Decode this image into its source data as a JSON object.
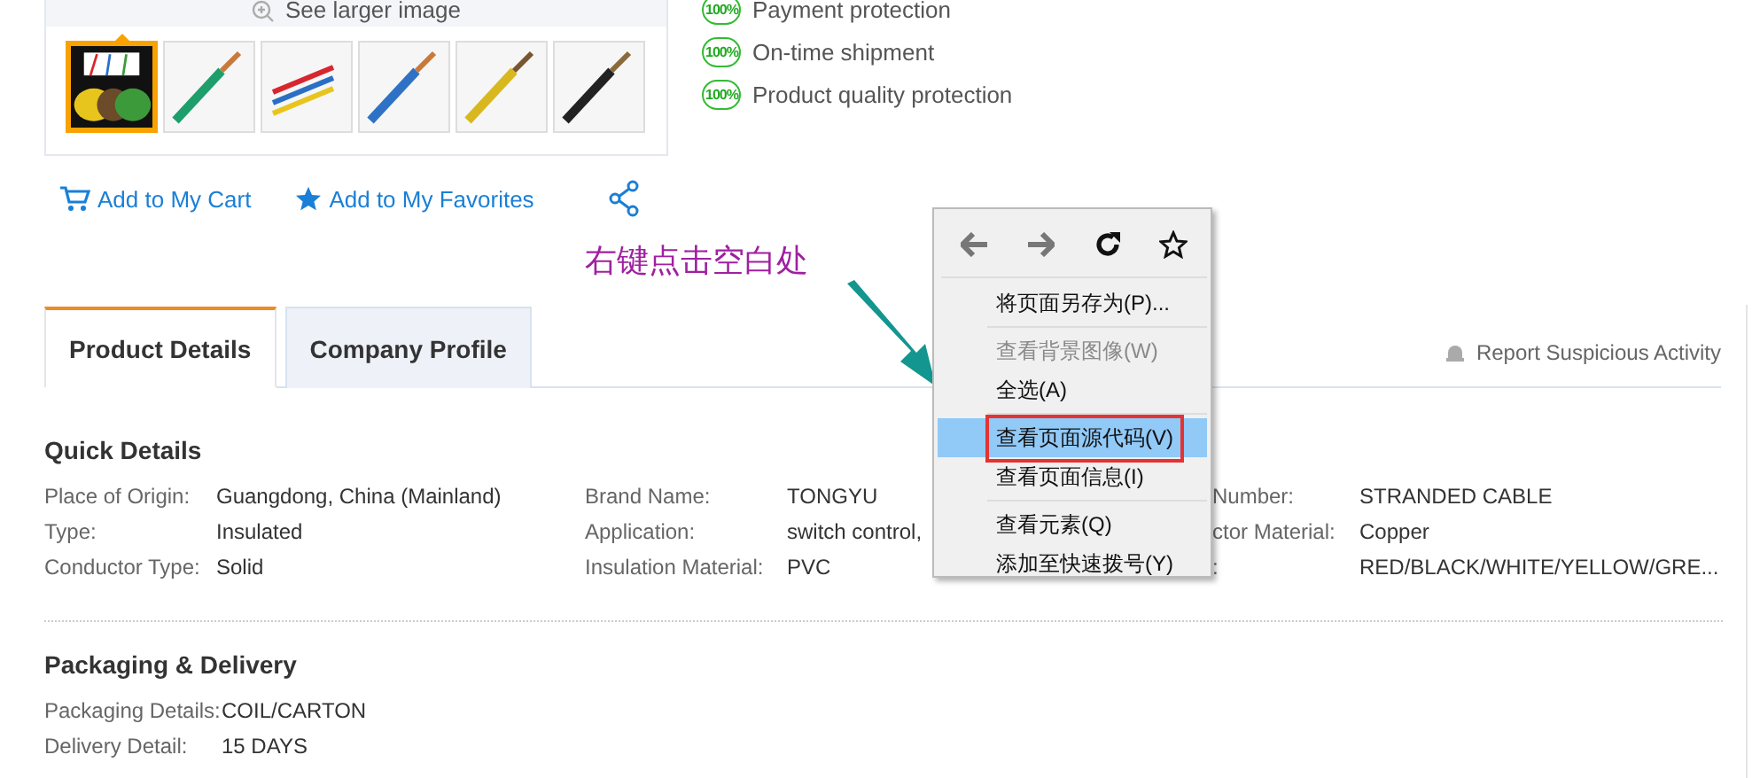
{
  "gallery": {
    "see_larger": "See larger image",
    "thumbnails": [
      {
        "kind": "picture",
        "selected": true
      },
      {
        "kind": "picture",
        "selected": false
      },
      {
        "kind": "picture",
        "selected": false
      },
      {
        "kind": "picture",
        "selected": false
      },
      {
        "kind": "picture",
        "selected": false
      },
      {
        "kind": "picture",
        "selected": false
      }
    ]
  },
  "actions": [
    {
      "kind": "cart",
      "label": "Add to My Cart"
    },
    {
      "kind": "favorite",
      "label": "Add to My Favorites"
    },
    {
      "kind": "share"
    }
  ],
  "guarantees": [
    {
      "badge": "100%",
      "label": "Payment protection"
    },
    {
      "badge": "100%",
      "label": "On-time shipment"
    },
    {
      "badge": "100%",
      "label": "Product quality protection"
    }
  ],
  "annotation": "右键点击空白处",
  "tabs": [
    {
      "label": "Product Details",
      "selected": true
    },
    {
      "label": "Company Profile",
      "selected": false
    }
  ],
  "report": "Report Suspicious Activity",
  "quick_details": {
    "title": "Quick Details",
    "rows": [
      [
        {
          "label": "Place of Origin:",
          "value": "Guangdong, China (Mainland)"
        },
        {
          "label": "Brand Name:",
          "value": "TONGYU"
        },
        {
          "label": "Number:",
          "value": "STRANDED CABLE"
        }
      ],
      [
        {
          "label": "Type:",
          "value": "Insulated"
        },
        {
          "label": "Application:",
          "value": "switch control,"
        },
        {
          "label": "ctor Material:",
          "value": "Copper"
        }
      ],
      [
        {
          "label": "Conductor Type:",
          "value": "Solid"
        },
        {
          "label": "Insulation Material:",
          "value": "PVC"
        },
        {
          "label": ":",
          "value": "RED/BLACK/WHITE/YELLOW/GRE..."
        }
      ]
    ]
  },
  "packaging": {
    "title": "Packaging & Delivery",
    "rows": [
      {
        "label": "Packaging Details:",
        "value": "COIL/CARTON"
      },
      {
        "label": "Delivery Detail:",
        "value": "15 DAYS"
      }
    ]
  },
  "context_menu": {
    "nav": [
      {
        "kind": "back",
        "disabled": true
      },
      {
        "kind": "forward",
        "disabled": true
      },
      {
        "kind": "reload",
        "disabled": false
      },
      {
        "kind": "bookmark",
        "disabled": false
      }
    ],
    "items": [
      {
        "kind": "item",
        "label": "将页面另存为(P)...",
        "disabled": false,
        "selected": false,
        "marked": false
      },
      {
        "kind": "separator"
      },
      {
        "kind": "item",
        "label": "查看背景图像(W)",
        "disabled": true,
        "selected": false,
        "marked": false
      },
      {
        "kind": "item",
        "label": "全选(A)",
        "disabled": false,
        "selected": false,
        "marked": false
      },
      {
        "kind": "separator"
      },
      {
        "kind": "item",
        "label": "查看页面源代码(V)",
        "disabled": false,
        "selected": true,
        "marked": true
      },
      {
        "kind": "item",
        "label": "查看页面信息(I)",
        "disabled": false,
        "selected": false,
        "marked": false
      },
      {
        "kind": "separator"
      },
      {
        "kind": "item",
        "label": "查看元素(Q)",
        "disabled": false,
        "selected": false,
        "marked": false
      },
      {
        "kind": "item",
        "label": "添加至快速拨号(Y)",
        "disabled": false,
        "selected": false,
        "marked": false
      }
    ]
  }
}
